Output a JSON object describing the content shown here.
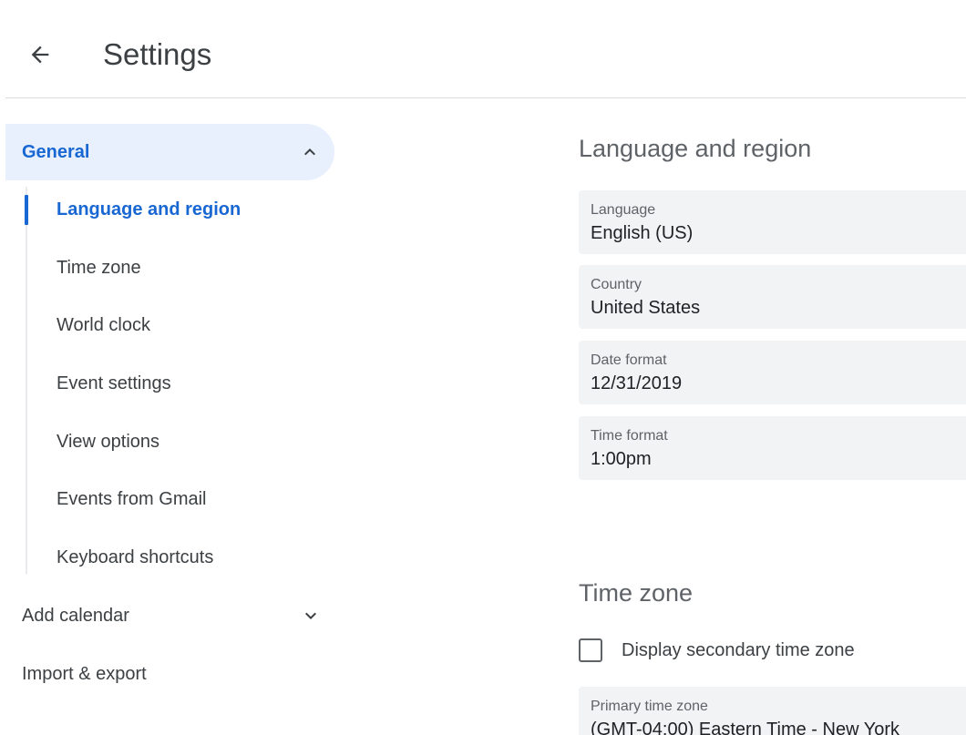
{
  "header": {
    "back_icon": "arrow-back-icon",
    "title": "Settings"
  },
  "sidebar": {
    "general": {
      "label": "General",
      "icon": "chevron-up-icon",
      "expanded": true
    },
    "sub_items": [
      {
        "label": "Language and region",
        "active": true
      },
      {
        "label": "Time zone"
      },
      {
        "label": "World clock"
      },
      {
        "label": "Event settings"
      },
      {
        "label": "View options"
      },
      {
        "label": "Events from Gmail"
      },
      {
        "label": "Keyboard shortcuts"
      }
    ],
    "add_calendar": {
      "label": "Add calendar",
      "icon": "chevron-down-icon"
    },
    "import_export": {
      "label": "Import & export"
    }
  },
  "main": {
    "language_region": {
      "title": "Language and region",
      "fields": [
        {
          "label": "Language",
          "value": "English (US)"
        },
        {
          "label": "Country",
          "value": "United States"
        },
        {
          "label": "Date format",
          "value": "12/31/2019"
        },
        {
          "label": "Time format",
          "value": "1:00pm"
        }
      ]
    },
    "time_zone": {
      "title": "Time zone",
      "secondary_checkbox": {
        "label": "Display secondary time zone",
        "checked": false
      },
      "primary": {
        "label": "Primary time zone",
        "value": "(GMT-04:00) Eastern Time - New York"
      }
    }
  },
  "colors": {
    "accent": "#1967d2",
    "active_bg": "#e8f0fe",
    "field_bg": "#f1f3f4",
    "divider": "#dadce0"
  }
}
